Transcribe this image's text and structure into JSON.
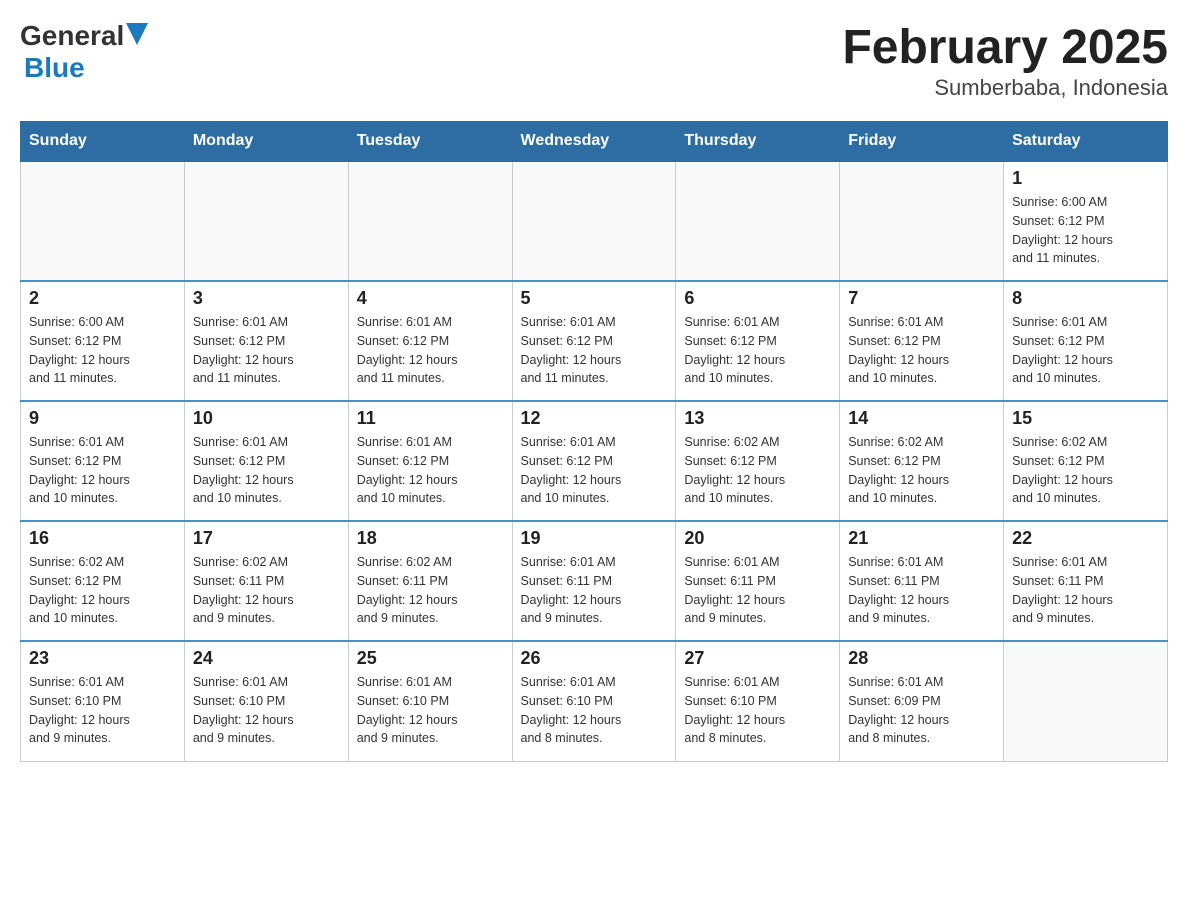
{
  "header": {
    "logo_general": "General",
    "logo_blue": "Blue",
    "title": "February 2025",
    "location": "Sumberbaba, Indonesia"
  },
  "days_of_week": [
    "Sunday",
    "Monday",
    "Tuesday",
    "Wednesday",
    "Thursday",
    "Friday",
    "Saturday"
  ],
  "weeks": [
    [
      {
        "day": "",
        "info": ""
      },
      {
        "day": "",
        "info": ""
      },
      {
        "day": "",
        "info": ""
      },
      {
        "day": "",
        "info": ""
      },
      {
        "day": "",
        "info": ""
      },
      {
        "day": "",
        "info": ""
      },
      {
        "day": "1",
        "info": "Sunrise: 6:00 AM\nSunset: 6:12 PM\nDaylight: 12 hours\nand 11 minutes."
      }
    ],
    [
      {
        "day": "2",
        "info": "Sunrise: 6:00 AM\nSunset: 6:12 PM\nDaylight: 12 hours\nand 11 minutes."
      },
      {
        "day": "3",
        "info": "Sunrise: 6:01 AM\nSunset: 6:12 PM\nDaylight: 12 hours\nand 11 minutes."
      },
      {
        "day": "4",
        "info": "Sunrise: 6:01 AM\nSunset: 6:12 PM\nDaylight: 12 hours\nand 11 minutes."
      },
      {
        "day": "5",
        "info": "Sunrise: 6:01 AM\nSunset: 6:12 PM\nDaylight: 12 hours\nand 11 minutes."
      },
      {
        "day": "6",
        "info": "Sunrise: 6:01 AM\nSunset: 6:12 PM\nDaylight: 12 hours\nand 10 minutes."
      },
      {
        "day": "7",
        "info": "Sunrise: 6:01 AM\nSunset: 6:12 PM\nDaylight: 12 hours\nand 10 minutes."
      },
      {
        "day": "8",
        "info": "Sunrise: 6:01 AM\nSunset: 6:12 PM\nDaylight: 12 hours\nand 10 minutes."
      }
    ],
    [
      {
        "day": "9",
        "info": "Sunrise: 6:01 AM\nSunset: 6:12 PM\nDaylight: 12 hours\nand 10 minutes."
      },
      {
        "day": "10",
        "info": "Sunrise: 6:01 AM\nSunset: 6:12 PM\nDaylight: 12 hours\nand 10 minutes."
      },
      {
        "day": "11",
        "info": "Sunrise: 6:01 AM\nSunset: 6:12 PM\nDaylight: 12 hours\nand 10 minutes."
      },
      {
        "day": "12",
        "info": "Sunrise: 6:01 AM\nSunset: 6:12 PM\nDaylight: 12 hours\nand 10 minutes."
      },
      {
        "day": "13",
        "info": "Sunrise: 6:02 AM\nSunset: 6:12 PM\nDaylight: 12 hours\nand 10 minutes."
      },
      {
        "day": "14",
        "info": "Sunrise: 6:02 AM\nSunset: 6:12 PM\nDaylight: 12 hours\nand 10 minutes."
      },
      {
        "day": "15",
        "info": "Sunrise: 6:02 AM\nSunset: 6:12 PM\nDaylight: 12 hours\nand 10 minutes."
      }
    ],
    [
      {
        "day": "16",
        "info": "Sunrise: 6:02 AM\nSunset: 6:12 PM\nDaylight: 12 hours\nand 10 minutes."
      },
      {
        "day": "17",
        "info": "Sunrise: 6:02 AM\nSunset: 6:11 PM\nDaylight: 12 hours\nand 9 minutes."
      },
      {
        "day": "18",
        "info": "Sunrise: 6:02 AM\nSunset: 6:11 PM\nDaylight: 12 hours\nand 9 minutes."
      },
      {
        "day": "19",
        "info": "Sunrise: 6:01 AM\nSunset: 6:11 PM\nDaylight: 12 hours\nand 9 minutes."
      },
      {
        "day": "20",
        "info": "Sunrise: 6:01 AM\nSunset: 6:11 PM\nDaylight: 12 hours\nand 9 minutes."
      },
      {
        "day": "21",
        "info": "Sunrise: 6:01 AM\nSunset: 6:11 PM\nDaylight: 12 hours\nand 9 minutes."
      },
      {
        "day": "22",
        "info": "Sunrise: 6:01 AM\nSunset: 6:11 PM\nDaylight: 12 hours\nand 9 minutes."
      }
    ],
    [
      {
        "day": "23",
        "info": "Sunrise: 6:01 AM\nSunset: 6:10 PM\nDaylight: 12 hours\nand 9 minutes."
      },
      {
        "day": "24",
        "info": "Sunrise: 6:01 AM\nSunset: 6:10 PM\nDaylight: 12 hours\nand 9 minutes."
      },
      {
        "day": "25",
        "info": "Sunrise: 6:01 AM\nSunset: 6:10 PM\nDaylight: 12 hours\nand 9 minutes."
      },
      {
        "day": "26",
        "info": "Sunrise: 6:01 AM\nSunset: 6:10 PM\nDaylight: 12 hours\nand 8 minutes."
      },
      {
        "day": "27",
        "info": "Sunrise: 6:01 AM\nSunset: 6:10 PM\nDaylight: 12 hours\nand 8 minutes."
      },
      {
        "day": "28",
        "info": "Sunrise: 6:01 AM\nSunset: 6:09 PM\nDaylight: 12 hours\nand 8 minutes."
      },
      {
        "day": "",
        "info": ""
      }
    ]
  ]
}
